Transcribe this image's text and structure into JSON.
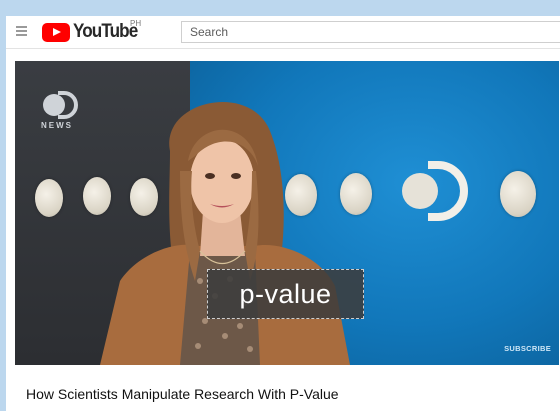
{
  "header": {
    "brand": "YouTube",
    "region": "PH",
    "search_placeholder": "Search"
  },
  "video": {
    "channel_logo_text": "NEWS",
    "caption": "p-value",
    "subscribe_label": "SUBSCRIBE",
    "title": "How Scientists Manipulate Research With P-Value"
  },
  "colors": {
    "page_bg": "#bcd7ee",
    "brand_red": "#ff0000",
    "video_blue": "#1177ba"
  }
}
